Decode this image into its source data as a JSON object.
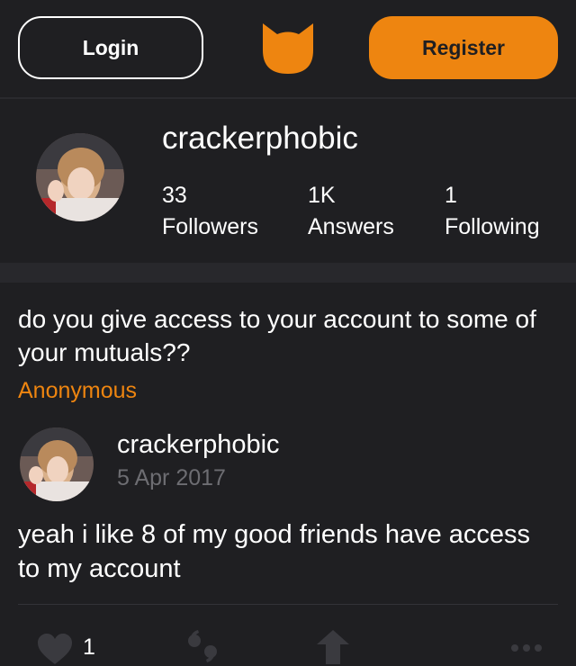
{
  "header": {
    "login_label": "Login",
    "register_label": "Register",
    "logo_icon": "cat-face-icon",
    "accent_color": "#ee8510"
  },
  "profile": {
    "username": "crackerphobic",
    "stats": [
      {
        "value": "33",
        "label": "Followers"
      },
      {
        "value": "1K",
        "label": "Answers"
      },
      {
        "value": "1",
        "label": "Following"
      }
    ]
  },
  "post": {
    "question": "do you give access to your account to some of your mutuals??",
    "asker": "Anonymous",
    "answerer": "crackerphobic",
    "date": "5 Apr 2017",
    "answer": "yeah i like 8 of my good friends have access to my account"
  },
  "actions": {
    "like_icon": "heart-icon",
    "like_count": "1",
    "share_icon": "quote-icon",
    "boost_icon": "arrow-up-icon",
    "more_icon": "more-dots-icon"
  }
}
